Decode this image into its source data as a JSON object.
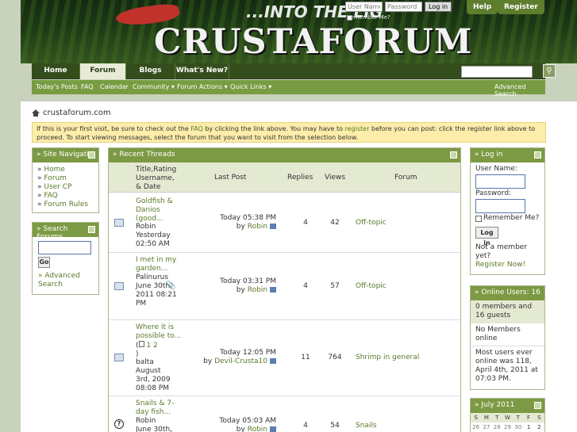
{
  "header": {
    "brand": "CRUSTAFORUM",
    "tagline": "...INTO THE LIG",
    "username_placeholder": "User Name",
    "password_placeholder": "Password",
    "login_button": "Log in",
    "remember_label": "Remember Me?",
    "help": "Help",
    "register": "Register"
  },
  "nav": {
    "tabs": [
      "Home",
      "Forum",
      "Blogs",
      "What's New?"
    ],
    "active_tab": "Forum",
    "search_icon": "magnifier-icon"
  },
  "subnav": {
    "items": [
      "Today's Posts",
      "FAQ",
      "Calendar",
      "Community ▾",
      "Forum Actions ▾",
      "Quick Links ▾"
    ],
    "advanced_search": "Advanced Search"
  },
  "breadcrumb": "crustaforum.com",
  "notice": {
    "p1": "If this is your first visit, be sure to check out the ",
    "faq": "FAQ",
    "p2": " by clicking the link above. You may have to ",
    "register": "register",
    "p3": " before you can post: click the register link above to proceed. To start viewing messages, select the forum that you want to visit from the selection below."
  },
  "site_nav": {
    "title": "» Site Navigatio",
    "items": [
      "Home",
      "Forum",
      "User CP",
      "FAQ",
      "Forum Rules"
    ]
  },
  "search_forums": {
    "title": "» Search Forums",
    "go": "Go",
    "advanced": "» Advanced Search"
  },
  "recent_threads": {
    "title": "» Recent Threads",
    "columns": {
      "title": "Title,Rating Username, & Date",
      "last_post": "Last Post",
      "replies": "Replies",
      "views": "Views",
      "forum": "Forum"
    },
    "rows": [
      {
        "title": "Goldfish & Danios (good...",
        "user": "Robin",
        "date": "Yesterday 02:50 AM",
        "lp_time": "Today 05:38 PM",
        "lp_by": "by",
        "lp_user": "Robin",
        "replies": "4",
        "views": "42",
        "forum": "Off-topic"
      },
      {
        "title": "I met in my garden...",
        "user": "Palinurus",
        "date": "June 30th, 2011 08:21 PM",
        "lp_time": "Today 03:31 PM",
        "lp_by": "by",
        "lp_user": "Robin",
        "replies": "4",
        "views": "57",
        "forum": "Off-topic"
      },
      {
        "title": "Where it is possible to...",
        "pages": "1 2",
        "user": "balta",
        "date": "August 3rd, 2009 08:08 PM",
        "lp_time": "Today 12:05 PM",
        "lp_by": "by",
        "lp_user": "Devil-Crusta10",
        "replies": "11",
        "views": "764",
        "forum": "Shrimp in general"
      },
      {
        "title": "Snails & 7-day fish...",
        "user": "Robin",
        "date": "June 30th,",
        "lp_time": "Today 05:03 AM",
        "lp_by": "by",
        "lp_user": "Robin",
        "replies": "4",
        "views": "54",
        "forum": "Snails"
      }
    ]
  },
  "login_box": {
    "title": "» Log in",
    "username": "User Name:",
    "password": "Password:",
    "remember": "Remember Me?",
    "button": "Log in",
    "not_member": "Not a member yet?",
    "register_now": "Register Now!"
  },
  "online": {
    "title": "» Online Users: 16",
    "summary": "0 members and 16 guests",
    "members": "No Members online",
    "record": "Most users ever online was 118, April 4th, 2011 at 07:03 PM."
  },
  "calendar": {
    "title": "» July 2011",
    "days": [
      "S",
      "M",
      "T",
      "W",
      "T",
      "F",
      "S"
    ],
    "first_row": [
      "26",
      "27",
      "28",
      "29",
      "30",
      "1",
      "2"
    ]
  },
  "colors": {
    "accent": "#7c9a44",
    "nav_dark": "#344d1c",
    "notice": "#fcedaa"
  }
}
